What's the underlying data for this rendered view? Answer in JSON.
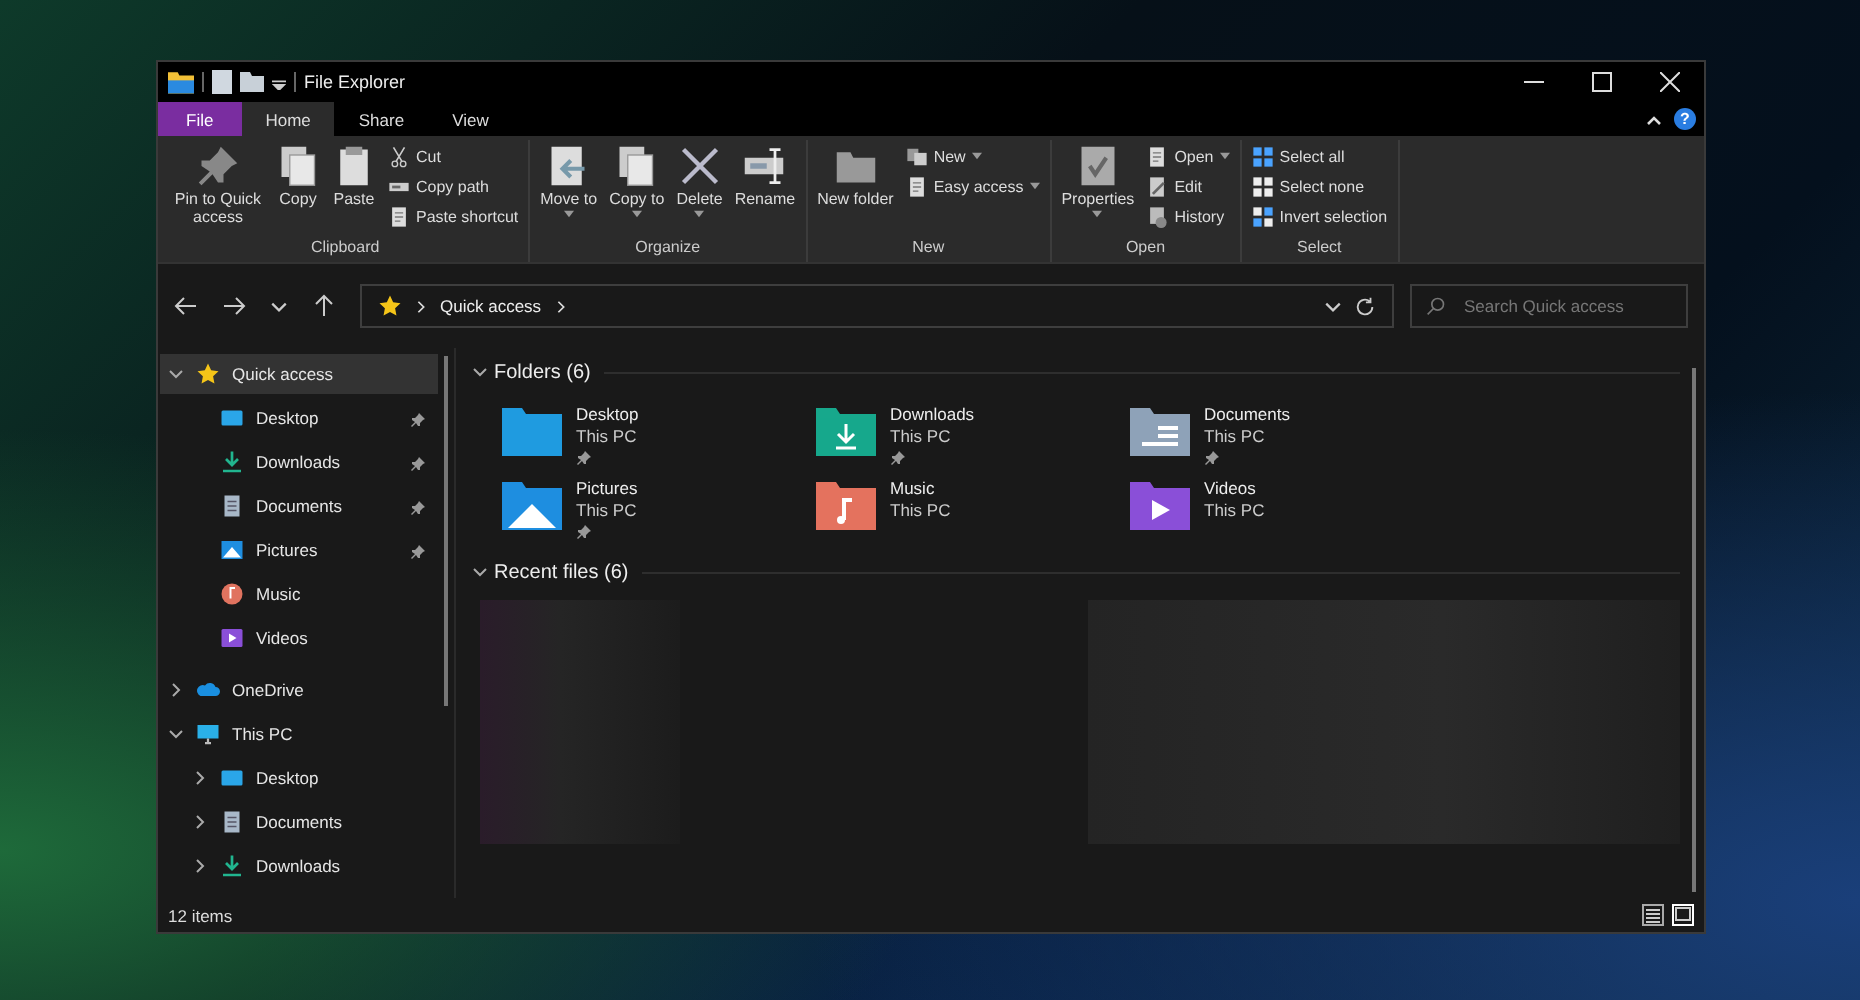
{
  "window": {
    "title": "File Explorer",
    "help": "?"
  },
  "ribbon_tabs": [
    {
      "label": "File",
      "kind": "file",
      "selected": false
    },
    {
      "label": "Home",
      "kind": "tab",
      "selected": true
    },
    {
      "label": "Share",
      "kind": "tab",
      "selected": false
    },
    {
      "label": "View",
      "kind": "tab",
      "selected": false
    }
  ],
  "ribbon_groups": [
    {
      "label": "Clipboard",
      "large": [
        {
          "label": "Pin to Quick access",
          "kind": "pin",
          "menu": false
        },
        {
          "label": "Copy",
          "kind": "copy",
          "menu": false
        },
        {
          "label": "Paste",
          "kind": "paste",
          "menu": false
        }
      ],
      "small": [
        {
          "label": "Cut",
          "kind": "cut",
          "menu": false
        },
        {
          "label": "Copy path",
          "kind": "copy-path",
          "menu": false
        },
        {
          "label": "Paste shortcut",
          "kind": "paste-shortcut",
          "menu": false
        }
      ]
    },
    {
      "label": "Organize",
      "large": [
        {
          "label": "Move to",
          "kind": "move",
          "menu": true
        },
        {
          "label": "Copy to",
          "kind": "copy",
          "menu": true
        },
        {
          "label": "Delete",
          "kind": "delete",
          "menu": true
        },
        {
          "label": "Rename",
          "kind": "rename",
          "menu": false
        }
      ]
    },
    {
      "label": "New",
      "large": [
        {
          "label": "New folder",
          "kind": "new-folder",
          "menu": false
        }
      ],
      "small": [
        {
          "label": "New",
          "kind": "new-item",
          "menu": true
        },
        {
          "label": "Easy access",
          "kind": "easy-access",
          "menu": true
        }
      ]
    },
    {
      "label": "Open",
      "large": [
        {
          "label": "Properties",
          "kind": "properties",
          "menu": true
        }
      ],
      "small": [
        {
          "label": "Open",
          "kind": "open",
          "menu": true
        },
        {
          "label": "Edit",
          "kind": "edit",
          "menu": false
        },
        {
          "label": "History",
          "kind": "history",
          "menu": false
        }
      ]
    },
    {
      "label": "Select",
      "small": [
        {
          "label": "Select all",
          "kind": "select-all",
          "menu": false
        },
        {
          "label": "Select none",
          "kind": "select-none",
          "menu": false
        },
        {
          "label": "Invert selection",
          "kind": "invert",
          "menu": false
        }
      ]
    }
  ],
  "address_bar": {
    "crumbs": [
      "Quick access"
    ]
  },
  "search": {
    "placeholder": "Search Quick access"
  },
  "nav_pane": {
    "items": [
      {
        "label": "Quick access",
        "kind": "star",
        "expanded": true,
        "selected": true,
        "children": [
          {
            "label": "Desktop",
            "kind": "desktop",
            "pinned": true,
            "selected": false
          },
          {
            "label": "Downloads",
            "kind": "downloads",
            "pinned": true,
            "selected": false
          },
          {
            "label": "Documents",
            "kind": "documents",
            "pinned": true,
            "selected": false
          },
          {
            "label": "Pictures",
            "kind": "pictures",
            "pinned": true,
            "selected": false
          },
          {
            "label": "Music",
            "kind": "music",
            "pinned": false,
            "selected": false
          },
          {
            "label": "Videos",
            "kind": "videos",
            "pinned": false,
            "selected": false
          }
        ]
      },
      {
        "label": "OneDrive",
        "kind": "onedrive",
        "expanded": false,
        "selected": false
      },
      {
        "label": "This PC",
        "kind": "pc",
        "expanded": true,
        "selected": false,
        "children": [
          {
            "label": "Desktop",
            "kind": "desktop",
            "expanded": false,
            "selected": false
          },
          {
            "label": "Documents",
            "kind": "documents",
            "expanded": false,
            "selected": false
          },
          {
            "label": "Downloads",
            "kind": "downloads",
            "expanded": false,
            "selected": false
          }
        ]
      }
    ]
  },
  "folders_section": {
    "title": "Folders (6)",
    "expanded": true,
    "items": [
      {
        "name": "Desktop",
        "location": "This PC",
        "kind": "desktop",
        "pinned": true
      },
      {
        "name": "Downloads",
        "location": "This PC",
        "kind": "downloads",
        "pinned": true
      },
      {
        "name": "Documents",
        "location": "This PC",
        "kind": "documents",
        "pinned": true
      },
      {
        "name": "Pictures",
        "location": "This PC",
        "kind": "pictures",
        "pinned": true
      },
      {
        "name": "Music",
        "location": "This PC",
        "kind": "music",
        "pinned": false
      },
      {
        "name": "Videos",
        "location": "This PC",
        "kind": "videos",
        "pinned": false
      }
    ]
  },
  "recent_section": {
    "title": "Recent files (6)",
    "expanded": true
  },
  "status_bar": {
    "count": "12 items",
    "views": [
      {
        "kind": "details",
        "selected": false
      },
      {
        "kind": "large-icons",
        "selected": true
      }
    ]
  }
}
